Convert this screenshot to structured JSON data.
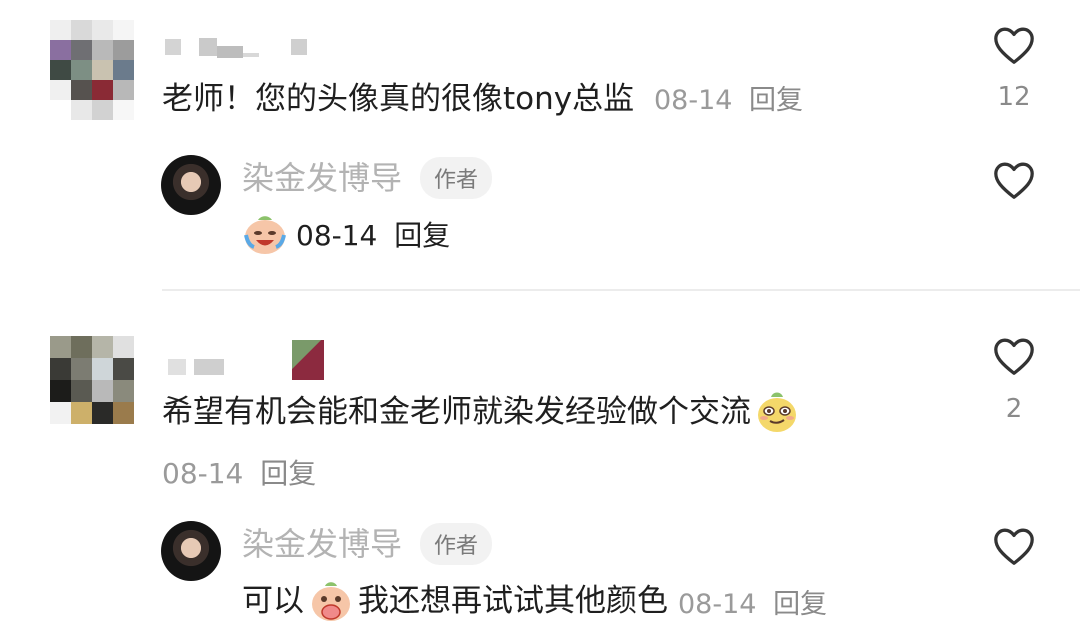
{
  "comments": [
    {
      "text": "老师！您的头像真的很像tony总监",
      "date": "08-14",
      "reply_label": "回复",
      "like_count": "12",
      "reply": {
        "author": "染金发博导",
        "badge": "作者",
        "emoji": "crying-laugh-emoji",
        "date": "08-14",
        "reply_label": "回复"
      }
    },
    {
      "text": "希望有机会能和金老师就染发经验做个交流",
      "emoji": "smirk-emoji",
      "date": "08-14",
      "reply_label": "回复",
      "like_count": "2",
      "reply": {
        "author": "染金发博导",
        "badge": "作者",
        "text_before": "可以",
        "emoji": "hand-over-mouth-emoji",
        "text_after": "我还想再试试其他颜色",
        "date": "08-14",
        "reply_label": "回复"
      }
    }
  ],
  "colors": {
    "text": "#1f1f1f",
    "meta": "#9a9a9a",
    "author": "#b3b3b3",
    "badge_bg": "#f2f2f2",
    "heart": "#333333"
  }
}
